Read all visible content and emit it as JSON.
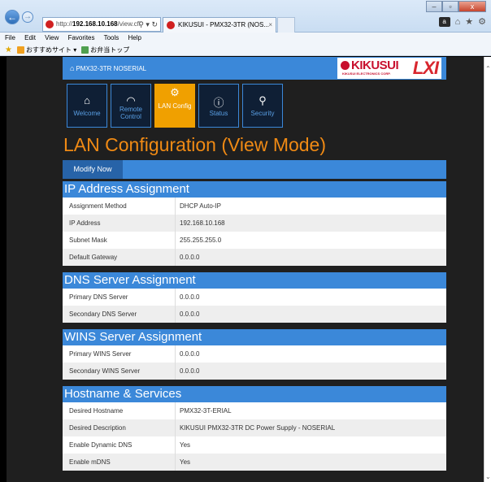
{
  "browser": {
    "address": {
      "prefix": "http://",
      "host": "192.168.10.168",
      "path": "/view.cfi"
    },
    "tab_title": "KIKUSUI - PMX32-3TR (NOS...",
    "menu": [
      "File",
      "Edit",
      "View",
      "Favorites",
      "Tools",
      "Help"
    ],
    "favorites": [
      "おすすめサイト ▾",
      "お弁当トップ"
    ]
  },
  "header": {
    "device_name": "PMX32-3TR NOSERIAL",
    "logo_text": "KIKUSUI",
    "logo_sub": "KIKUSUI ELECTRONICS CORP.",
    "lxi_text": "LXI"
  },
  "nav_tiles": [
    {
      "label": "Welcome",
      "icon": "home-icon"
    },
    {
      "label": "Remote Control",
      "icon": "gauge-icon"
    },
    {
      "label": "LAN Config",
      "icon": "gear-icon"
    },
    {
      "label": "Status",
      "icon": "info-icon"
    },
    {
      "label": "Security",
      "icon": "key-icon"
    }
  ],
  "page_title": "LAN Configuration (View Mode)",
  "modify_label": "Modify Now",
  "sections": [
    {
      "title": "IP Address Assignment",
      "rows": [
        {
          "key": "Assignment Method",
          "value": "DHCP  Auto-IP"
        },
        {
          "key": "IP Address",
          "value": "192.168.10.168"
        },
        {
          "key": "Subnet Mask",
          "value": "255.255.255.0"
        },
        {
          "key": "Default Gateway",
          "value": "0.0.0.0"
        }
      ]
    },
    {
      "title": "DNS Server Assignment",
      "rows": [
        {
          "key": "Primary DNS Server",
          "value": "0.0.0.0"
        },
        {
          "key": "Secondary DNS Server",
          "value": "0.0.0.0"
        }
      ]
    },
    {
      "title": "WINS Server Assignment",
      "rows": [
        {
          "key": "Primary WINS Server",
          "value": "0.0.0.0"
        },
        {
          "key": "Secondary WINS Server",
          "value": "0.0.0.0"
        }
      ]
    },
    {
      "title": "Hostname & Services",
      "rows": [
        {
          "key": "Desired Hostname",
          "value": "PMX32-3T-ERIAL"
        },
        {
          "key": "Desired Description",
          "value": "KIKUSUI PMX32-3TR DC Power Supply - NOSERIAL"
        },
        {
          "key": "Enable Dynamic DNS",
          "value": "Yes"
        },
        {
          "key": "Enable mDNS",
          "value": "Yes"
        }
      ]
    }
  ]
}
